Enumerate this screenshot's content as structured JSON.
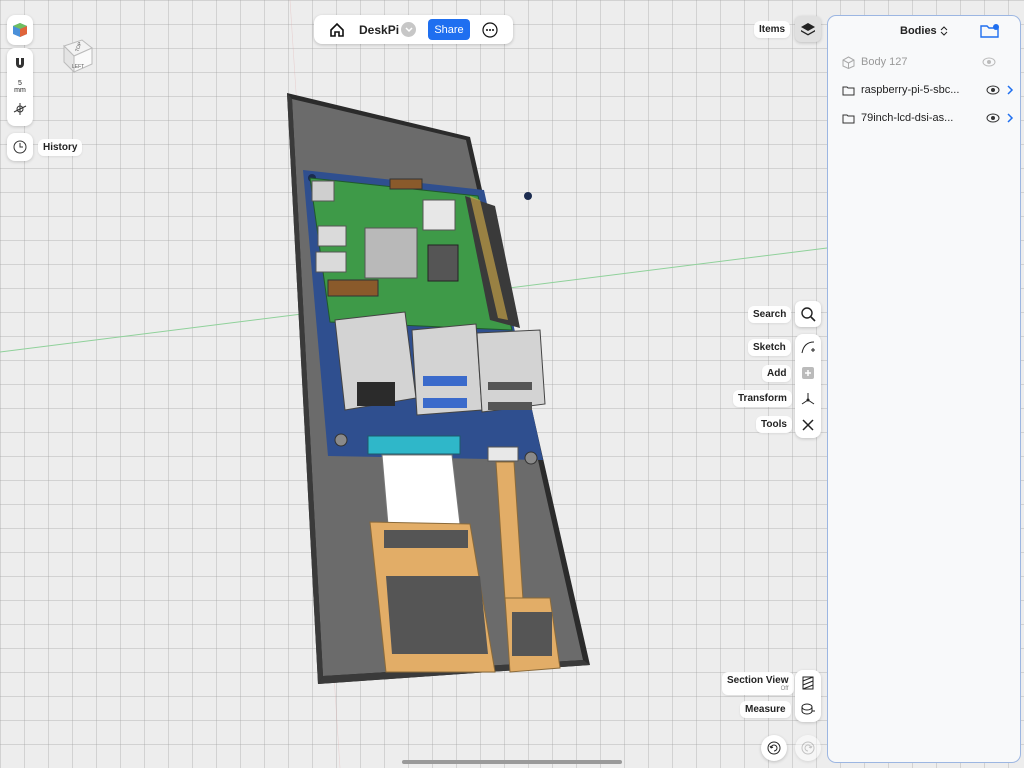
{
  "toolbar": {
    "title": "DeskPi",
    "share_label": "Share"
  },
  "left_tools": {
    "unit_value": "5",
    "unit_label": "mm",
    "history_label": "History"
  },
  "viewcube": {
    "face_label": "TOP",
    "side_label": "LEFT"
  },
  "right_tools": {
    "items_label": "Items",
    "search_label": "Search",
    "sketch_label": "Sketch",
    "add_label": "Add",
    "transform_label": "Transform",
    "tools_label": "Tools",
    "section_view_label": "Section View",
    "section_view_state": "Off",
    "measure_label": "Measure"
  },
  "panel": {
    "title": "Bodies",
    "items": [
      {
        "label": "Body 127",
        "type": "body",
        "hidden": true
      },
      {
        "label": "raspberry-pi-5-sbc...",
        "type": "folder",
        "hidden": false
      },
      {
        "label": "79inch-lcd-dsi-as...",
        "type": "folder",
        "hidden": false
      }
    ]
  },
  "colors": {
    "accent": "#1f6ff0",
    "pcb": "#3e9a48",
    "carrier": "#2f4f8f",
    "case": "#6b6b6b",
    "flex": "#e2ad67"
  }
}
